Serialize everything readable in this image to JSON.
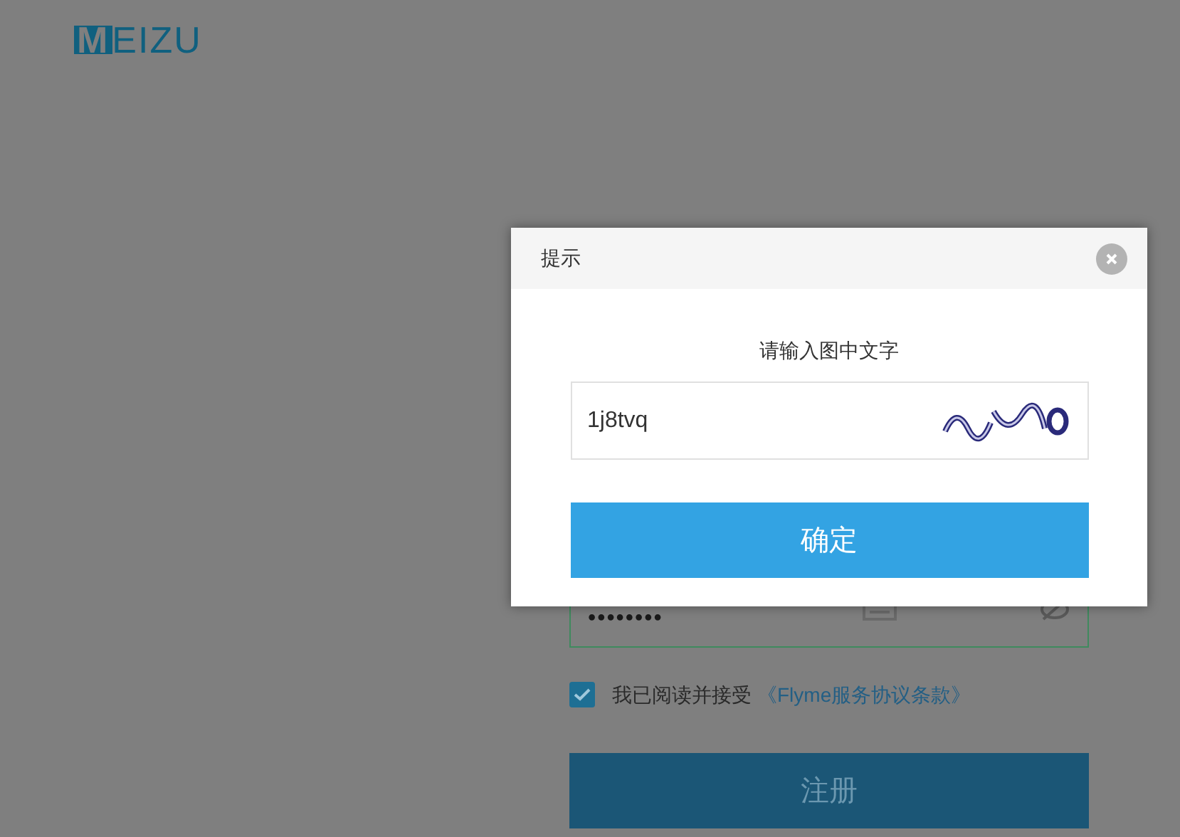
{
  "logo": {
    "text": "MEIZU"
  },
  "form": {
    "password": {
      "value": "••••••••"
    },
    "agreement": {
      "checked": true,
      "label": "我已阅读并接受",
      "link": "《Flyme服务协议条款》"
    },
    "submit": "注册"
  },
  "dialog": {
    "title": "提示",
    "prompt": "请输入图中文字",
    "captcha": {
      "value": "1j8tvq"
    },
    "confirm": "确定"
  }
}
